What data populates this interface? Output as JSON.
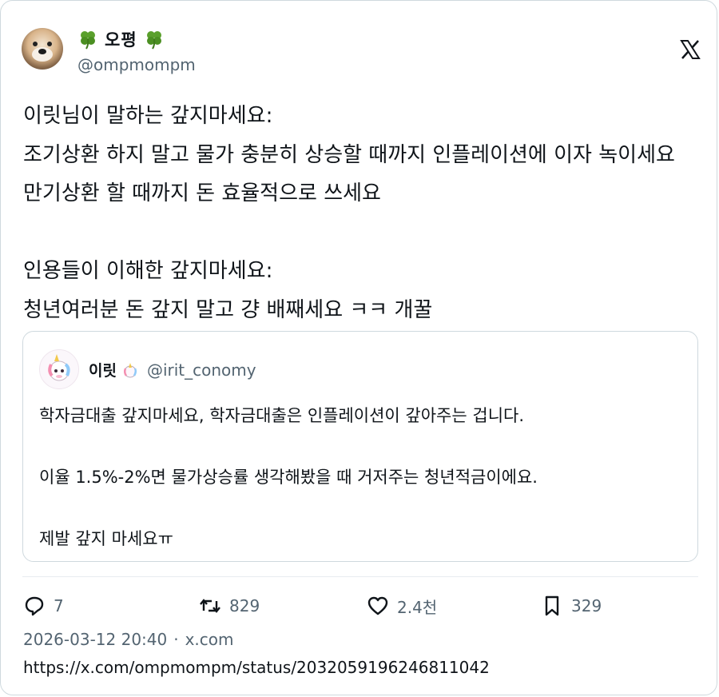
{
  "author": {
    "display_name": "오평",
    "handle": "@ompmompm"
  },
  "tweet": {
    "text": "이릿님이 말하는 갚지마세요:\n조기상환 하지 말고 물가 충분히 상승할 때까지 인플레이션에 이자 녹이세요 만기상환 할 때까지 돈 효율적으로 쓰세요\n\n인용들이 이해한 갚지마세요:\n청년여러분 돈 갚지 말고 걍 배째세요 ㅋㅋ 개꿀"
  },
  "quoted": {
    "display_name": "이릿",
    "handle": "@irit_conomy",
    "text": "학자금대출 갚지마세요, 학자금대출은 인플레이션이 갚아주는 겁니다.\n\n이율 1.5%-2%면 물가상승률 생각해봤을 때 거저주는 청년적금이에요.\n\n제발 갚지 마세요ㅠ"
  },
  "actions": {
    "reply_count": "7",
    "repost_count": "829",
    "like_count": "2.4천",
    "bookmark_count": "329"
  },
  "meta": {
    "timestamp": "2026-03-12 20:40",
    "separator": "·",
    "source": "x.com",
    "url": "https://x.com/ompmompm/status/2032059196246811042"
  },
  "icons": {
    "author_name_decoration": "four-leaf-clover-icon",
    "quoted_name_decoration": "unicorn-icon",
    "platform_logo": "x-logo-icon"
  },
  "colors": {
    "text_primary": "#0f1419",
    "text_secondary": "#536471",
    "border": "#cfd9de",
    "clover_green": "#5aa02c"
  }
}
